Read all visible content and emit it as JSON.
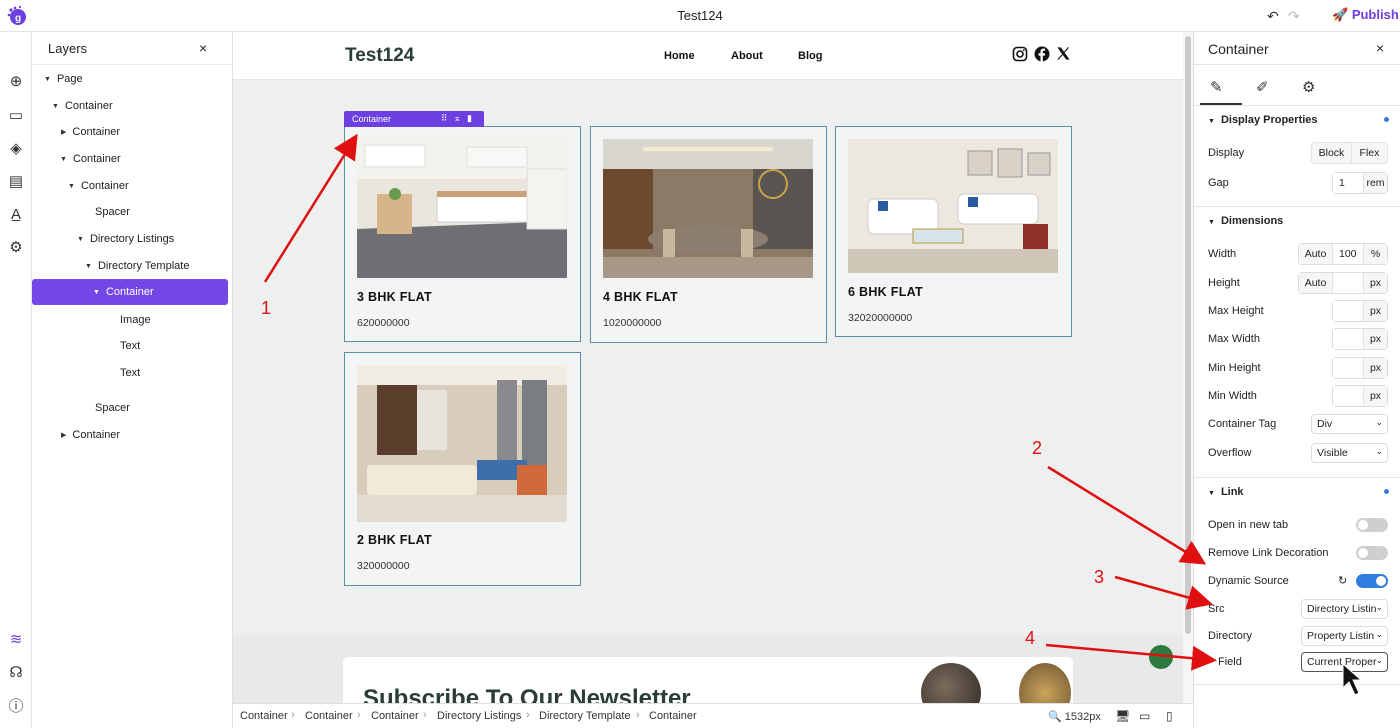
{
  "app": {
    "title": "Test124",
    "publish_label": "Publish"
  },
  "rail_icons": [
    "plus-icon",
    "section-icon",
    "components-icon",
    "pages-icon",
    "typography-icon",
    "settings-icon",
    "layers-icon",
    "support-icon",
    "info-icon"
  ],
  "layers": {
    "title": "Layers",
    "close": "×",
    "items": [
      {
        "label": "Page",
        "caret": "▼"
      },
      {
        "label": "Container",
        "caret": "▼"
      },
      {
        "label": "Container",
        "caret": "▶"
      },
      {
        "label": "Container",
        "caret": "▼"
      },
      {
        "label": "Container",
        "caret": "▼"
      },
      {
        "label": "Spacer",
        "caret": ""
      },
      {
        "label": "Directory Listings",
        "caret": "▼"
      },
      {
        "label": "Directory Template",
        "caret": "▼"
      },
      {
        "label": "Container",
        "caret": "▼",
        "selected": true
      },
      {
        "label": "Image",
        "caret": ""
      },
      {
        "label": "Text",
        "caret": ""
      },
      {
        "label": "Text",
        "caret": ""
      },
      {
        "label": "Spacer",
        "caret": ""
      },
      {
        "label": "Container",
        "caret": "▶"
      }
    ]
  },
  "site": {
    "brand": "Test124",
    "nav": [
      "Home",
      "About",
      "Blog"
    ],
    "social": [
      "instagram-icon",
      "facebook-icon",
      "x-icon"
    ],
    "container_tag": "Container",
    "cards": [
      {
        "title": "3 BHK FLAT",
        "price": "620000000"
      },
      {
        "title": "4 BHK FLAT",
        "price": "1020000000"
      },
      {
        "title": "6 BHK FLAT",
        "price": "32020000000"
      },
      {
        "title": "2 BHK FLAT",
        "price": "320000000"
      }
    ],
    "newsletter_title": "Subscribe To Our Newsletter"
  },
  "breadcrumb": [
    "Container",
    "Container",
    "Container",
    "Directory Listings",
    "Directory Template",
    "Container"
  ],
  "zoom": "1532px",
  "panel": {
    "title": "Container",
    "close": "×",
    "sections": {
      "display": "Display Properties",
      "dimensions": "Dimensions",
      "link": "Link"
    },
    "display": {
      "label": "Display",
      "options": [
        "Block",
        "Flex"
      ]
    },
    "gap": {
      "label": "Gap",
      "value": "1",
      "unit": "rem"
    },
    "width": {
      "label": "Width",
      "auto": "Auto",
      "value": "100",
      "unit": "%"
    },
    "height": {
      "label": "Height",
      "auto": "Auto",
      "value": "",
      "unit": "px"
    },
    "max_height": {
      "label": "Max Height",
      "value": "",
      "unit": "px"
    },
    "max_width": {
      "label": "Max Width",
      "value": "",
      "unit": "px"
    },
    "min_height": {
      "label": "Min Height",
      "value": "",
      "unit": "px"
    },
    "min_width": {
      "label": "Min Width",
      "value": "",
      "unit": "px"
    },
    "container_tag": {
      "label": "Container Tag",
      "value": "Div"
    },
    "overflow": {
      "label": "Overflow",
      "value": "Visible"
    },
    "open_new_tab": {
      "label": "Open in new tab",
      "on": false
    },
    "remove_decoration": {
      "label": "Remove Link Decoration",
      "on": false
    },
    "dynamic_source": {
      "label": "Dynamic Source",
      "on": true
    },
    "src": {
      "label": "Src",
      "value": "Directory Listin"
    },
    "directory": {
      "label": "Directory",
      "value": "Property Listin"
    },
    "field": {
      "label": "Field",
      "value": "Current Proper"
    }
  },
  "annotations": [
    "1",
    "2",
    "3",
    "4"
  ],
  "colors": {
    "accent": "#6b3fe0",
    "toggle_on": "#2f7fe0",
    "arrow": "#e01010",
    "card_border": "#5c8fa6"
  }
}
